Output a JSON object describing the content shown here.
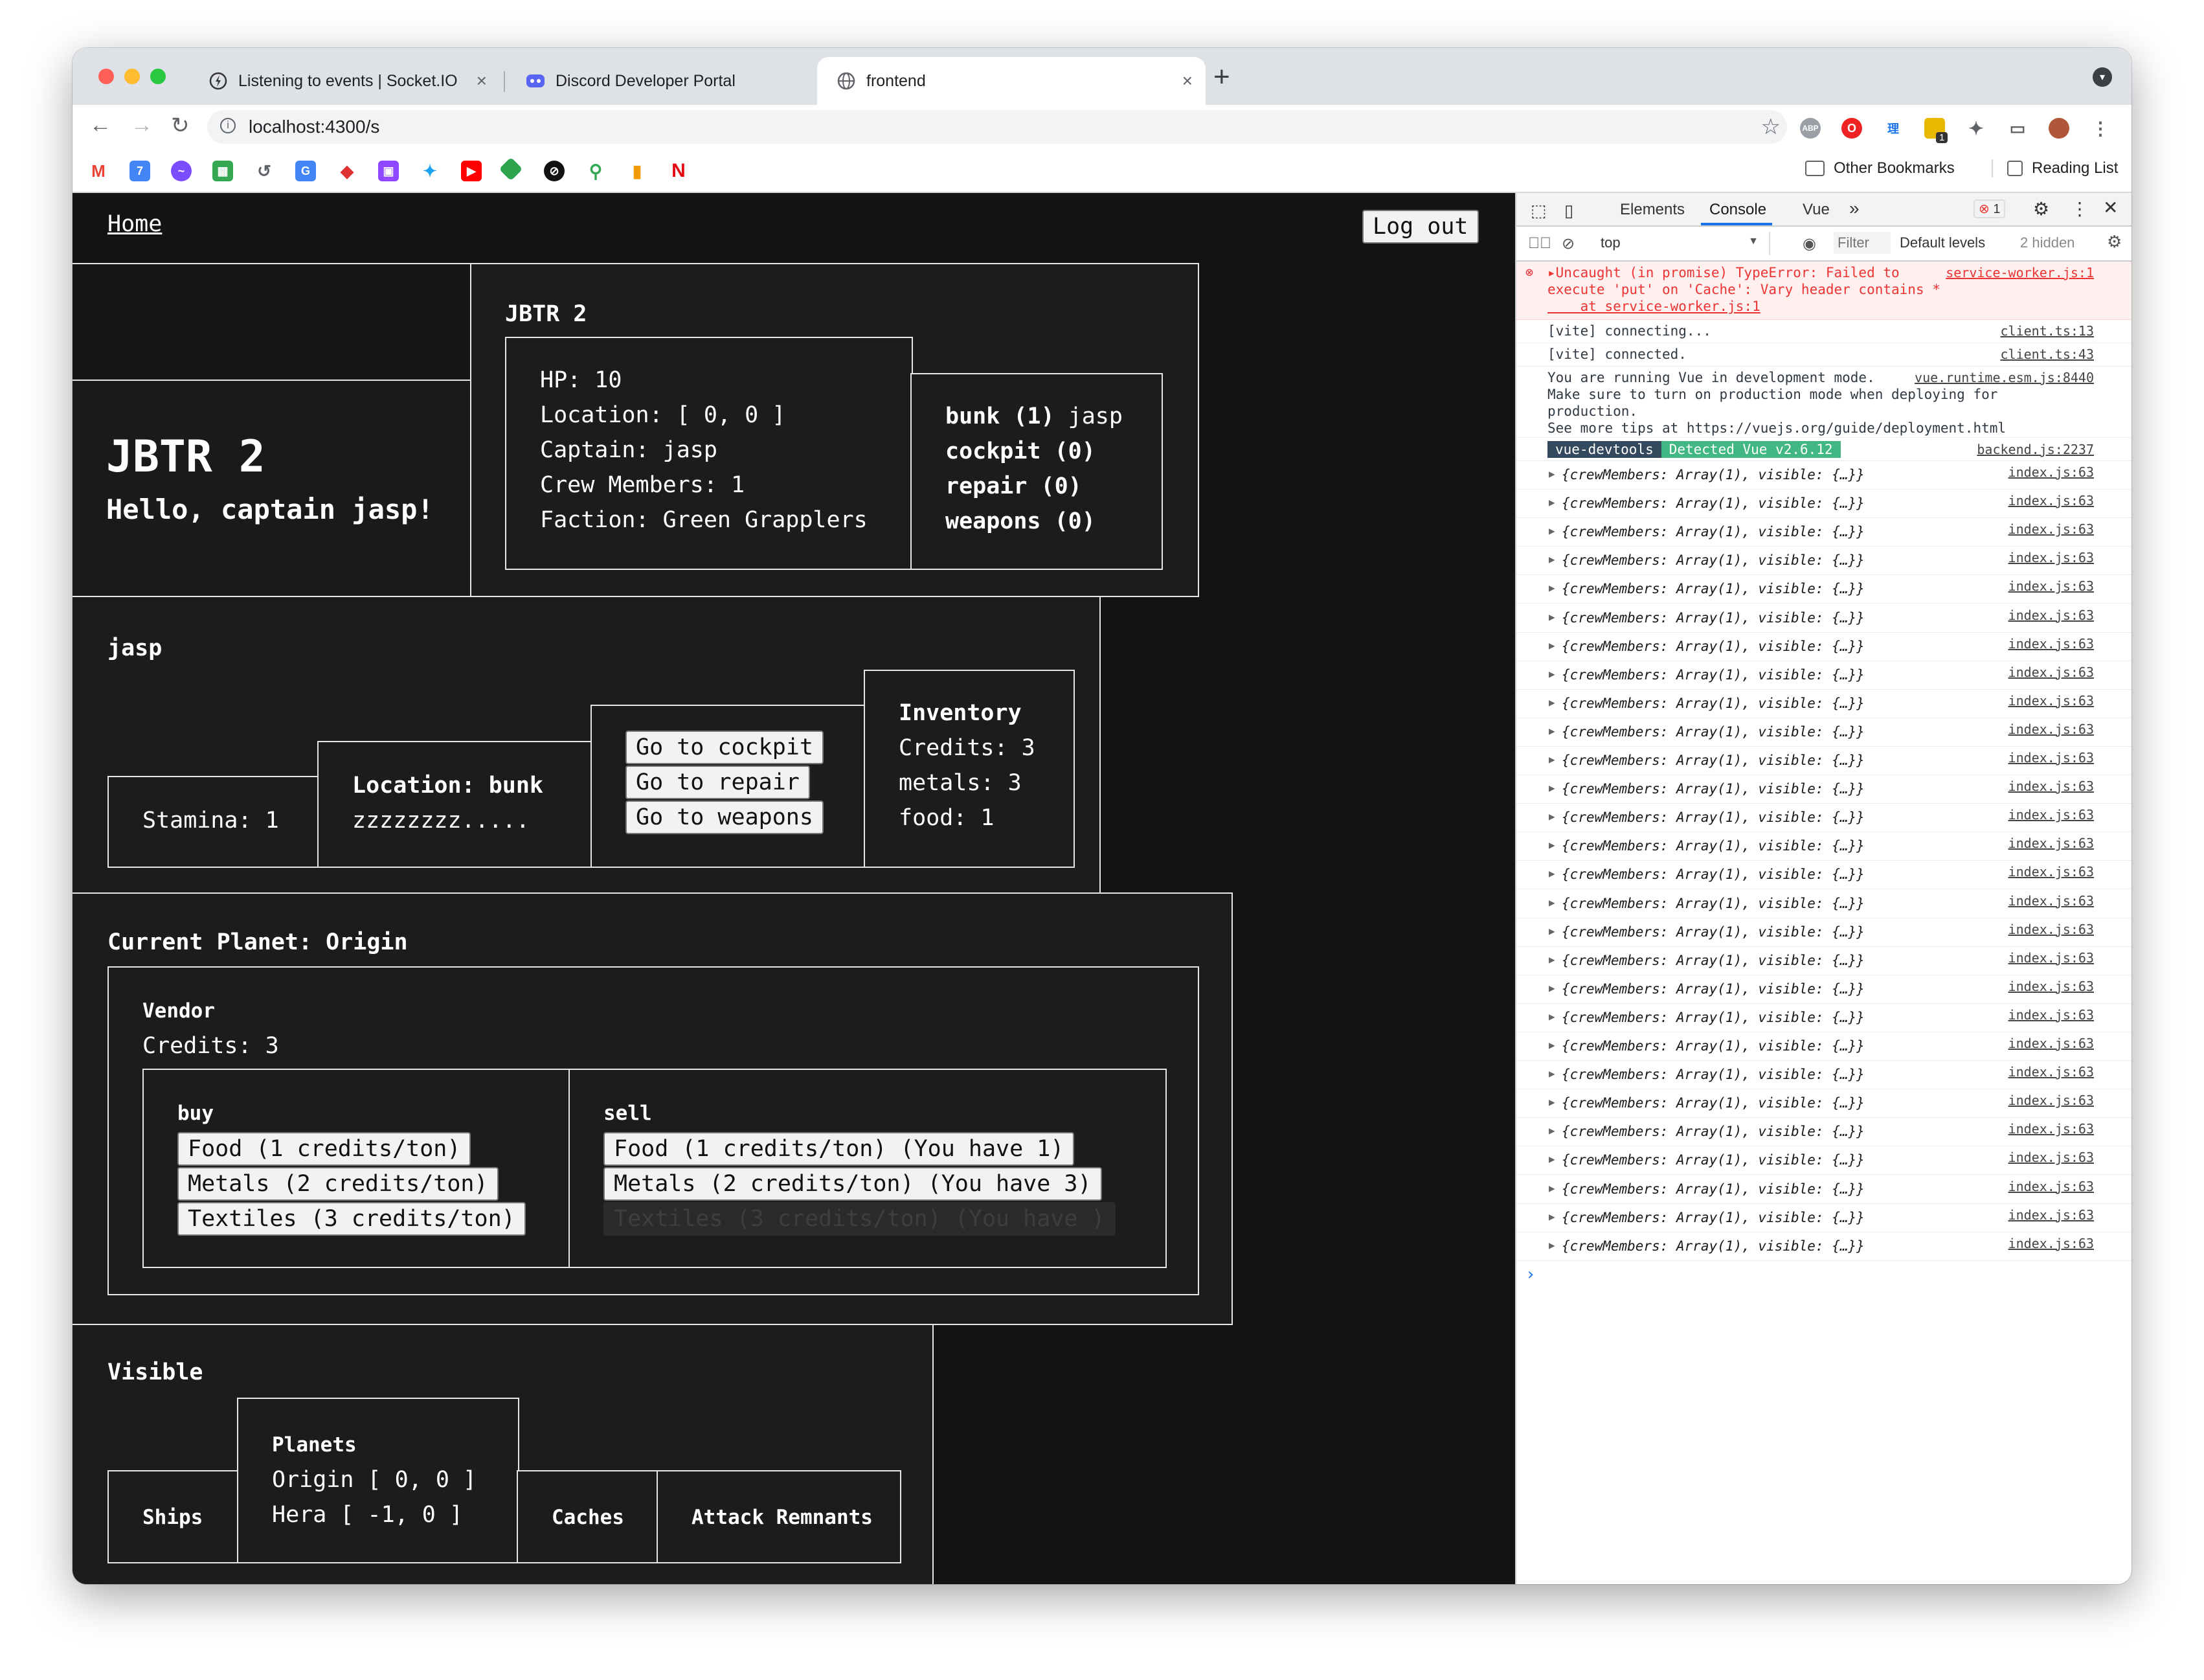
{
  "browser": {
    "tabs": [
      {
        "title": "Listening to events | Socket.IO",
        "icon": "socketio-icon"
      },
      {
        "title": "Discord Developer Portal",
        "icon": "discord-icon"
      },
      {
        "title": "frontend",
        "icon": "globe-icon"
      }
    ],
    "close_glyph": "×",
    "new_tab_glyph": "+",
    "url": "localhost:4300/s",
    "bookmarks": {
      "other": "Other Bookmarks",
      "reading": "Reading List"
    },
    "extension_badge": "1"
  },
  "app": {
    "home_link": "Home",
    "logout_label": "Log out",
    "ship": {
      "name_heading": "JBTR 2",
      "greeting": "Hello, captain jasp!",
      "panel_title": "JBTR 2",
      "stats": [
        "HP: 10",
        "Location: [ 0, 0 ]",
        "Captain: jasp",
        "Crew Members: 1",
        "Faction: Green Grapplers"
      ],
      "rooms": [
        {
          "name": "bunk (1)",
          "crew": " jasp"
        },
        {
          "name": "cockpit (0)",
          "crew": ""
        },
        {
          "name": "repair (0)",
          "crew": ""
        },
        {
          "name": "weapons (0)",
          "crew": ""
        }
      ]
    },
    "crew": {
      "name": "jasp",
      "stamina": "Stamina: 1",
      "location_label": "Location: bunk",
      "status": "zzzzzzzz.....",
      "actions": [
        "Go to cockpit",
        "Go to repair",
        "Go to weapons"
      ],
      "inventory": {
        "title": "Inventory",
        "items": [
          "Credits: 3",
          "metals: 3",
          "food: 1"
        ]
      }
    },
    "planet": {
      "title": "Current Planet: Origin",
      "vendor_title": "Vendor",
      "vendor_credits": "Credits: 3",
      "buy_title": "buy",
      "buy_items": [
        "Food (1 credits/ton)",
        "Metals (2 credits/ton)",
        "Textiles (3 credits/ton)"
      ],
      "sell_title": "sell",
      "sell_items": [
        "Food (1 credits/ton) (You have 1)",
        "Metals (2 credits/ton) (You have 3)",
        "Textiles (3 credits/ton) (You have )"
      ]
    },
    "visible": {
      "title": "Visible",
      "ships_label": "Ships",
      "planets_title": "Planets",
      "planets": [
        "Origin [ 0, 0 ]",
        "Hera [ -1, 0 ]"
      ],
      "caches_label": "Caches",
      "remnants_label": "Attack Remnants"
    }
  },
  "devtools": {
    "tabs": [
      "Elements",
      "Console",
      "Vue"
    ],
    "more_tabs": "»",
    "error_count": "1",
    "context": "top",
    "filter_placeholder": "Filter",
    "levels": "Default levels",
    "hidden": "2 hidden",
    "error": {
      "lines": [
        "▸Uncaught (in promise) TypeError: Failed to",
        "execute 'put' on 'Cache': Vary header contains *",
        "    at service-worker.js:1"
      ],
      "source": "service-worker.js:1"
    },
    "logs": [
      {
        "text": "[vite] connecting...",
        "source": "client.ts:13"
      },
      {
        "text": "[vite] connected.",
        "source": "client.ts:43"
      }
    ],
    "vue_notice": {
      "lines": [
        "You are running Vue in development mode.",
        "Make sure to turn on production mode when deploying for",
        "production.",
        "See more tips at https://vuejs.org/guide/deployment.html"
      ],
      "source": "vue.runtime.esm.js:8440"
    },
    "devtools_badge": "vue-devtools",
    "detected_badge": "Detected Vue v2.6.12",
    "devtools_source": "backend.js:2237",
    "object_entry": "{crewMembers: Array(1), visible: {…}}",
    "object_source": "index.js:63",
    "object_count": 28,
    "prompt": "›"
  }
}
